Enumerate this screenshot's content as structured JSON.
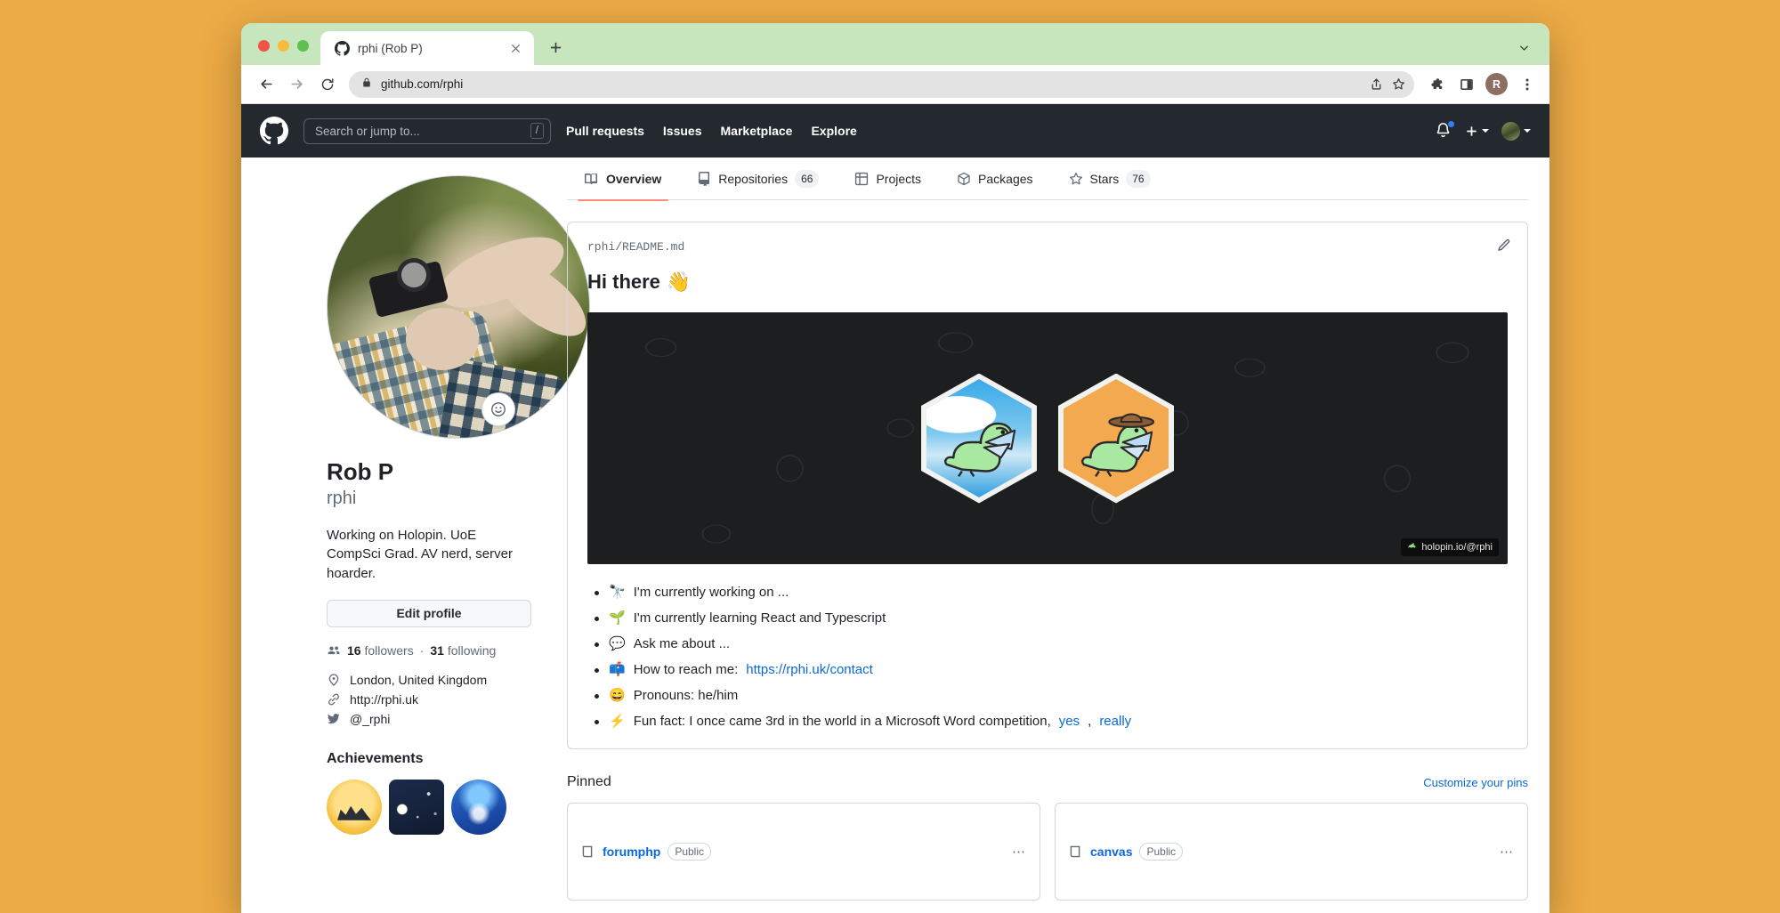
{
  "browser": {
    "tab": {
      "title": "rphi (Rob P)",
      "favicon": "github-icon"
    },
    "new_tab_label": "+",
    "address": "github.com/rphi",
    "lock_icon": "lock-icon",
    "back_icon": "back-arrow-icon",
    "forward_icon": "forward-arrow-icon",
    "reload_icon": "reload-icon",
    "share_icon": "share-icon",
    "bookmark_icon": "star-icon",
    "extensions_icon": "puzzle-icon",
    "sidepanel_icon": "side-panel-icon",
    "profile_initial": "R",
    "menu_icon": "three-dot-menu-icon",
    "tab_list_icon": "chevron-down-icon",
    "tabstrip_color": "#c8e6bd"
  },
  "github_header": {
    "logo": "github-octocat-logo",
    "search_placeholder": "Search or jump to...",
    "search_shortcut": "/",
    "nav": [
      {
        "label": "Pull requests"
      },
      {
        "label": "Issues"
      },
      {
        "label": "Marketplace"
      },
      {
        "label": "Explore"
      }
    ],
    "notifications_icon": "bell-icon",
    "has_unread": true,
    "unread_color": "#2f81f7",
    "create_new_icon": "plus-icon",
    "account_icon": "user-avatar"
  },
  "profile": {
    "avatar_alt": "person lying in grass holding a camera",
    "status_button_icon": "smiley-face-icon",
    "name": "Rob P",
    "login": "rphi",
    "bio": "Working on Holopin. UoE CompSci Grad. AV nerd, server hoarder.",
    "edit_button": "Edit profile",
    "followers_count": "16",
    "followers_label": "followers",
    "separator": "·",
    "following_count": "31",
    "following_label": "following",
    "people_icon": "people-icon",
    "details": [
      {
        "icon": "location-icon",
        "text": "London, United Kingdom"
      },
      {
        "icon": "link-icon",
        "text": "http://rphi.uk"
      },
      {
        "icon": "twitter-icon",
        "text": "@_rphi"
      }
    ],
    "achievements_title": "Achievements",
    "achievements": [
      {
        "name": "mars-2020-contributor-badge"
      },
      {
        "name": "starstruck-badge"
      },
      {
        "name": "pull-shark-badge"
      }
    ]
  },
  "tabs": [
    {
      "label": "Overview",
      "icon": "book-icon",
      "count": null,
      "active": true
    },
    {
      "label": "Repositories",
      "icon": "repo-icon",
      "count": "66",
      "active": false
    },
    {
      "label": "Projects",
      "icon": "project-board-icon",
      "count": null,
      "active": false
    },
    {
      "label": "Packages",
      "icon": "package-icon",
      "count": null,
      "active": false
    },
    {
      "label": "Stars",
      "icon": "star-icon",
      "count": "76",
      "active": false
    }
  ],
  "readme": {
    "owner": "rphi",
    "slash": "/",
    "file": "README.md",
    "edit_icon": "pencil-icon",
    "heading": "Hi there",
    "heading_emoji": "👋",
    "banner": {
      "watermark": "holopin.io/@rphi",
      "watermark_icon": "holopin-dino-icon",
      "background_color": "#1d1e20",
      "badges": [
        {
          "name": "winged-dino-sky-badge",
          "bg": "#39a9e8"
        },
        {
          "name": "cowboy-dino-orange-badge",
          "bg": "#f2a94f"
        }
      ]
    },
    "bullets": [
      {
        "emoji": "🔭",
        "text": "I'm currently working on ...",
        "link": null,
        "link_text": null,
        "tail": null
      },
      {
        "emoji": "🌱",
        "text": "I'm currently learning React and Typescript",
        "link": null,
        "link_text": null,
        "tail": null
      },
      {
        "emoji": "💬",
        "text": "Ask me about ...",
        "link": null,
        "link_text": null,
        "tail": null
      },
      {
        "emoji": "📫",
        "text": "How to reach me: ",
        "link_text": "https://rphi.uk/contact",
        "tail": null
      },
      {
        "emoji": "😄",
        "text": "Pronouns: he/him",
        "link": null,
        "link_text": null,
        "tail": null
      },
      {
        "emoji": "⚡",
        "text": "Fun fact: I once came 3rd in the world in a Microsoft Word competition, ",
        "link_text": "yes",
        "tail": ", ",
        "link_text2": "really"
      }
    ]
  },
  "pinned": {
    "title": "Pinned",
    "customize_link": "Customize your pins",
    "cards": [
      {
        "name": "forumphp",
        "visibility": "Public",
        "menu_icon": "kebab-menu-icon",
        "repo_icon": "repo-icon"
      },
      {
        "name": "canvas",
        "visibility": "Public",
        "menu_icon": "kebab-menu-icon",
        "repo_icon": "repo-icon"
      }
    ]
  },
  "colors": {
    "page_background": "#edab45",
    "gh_header": "#24292f",
    "accent_link": "#0969da",
    "active_tab_underline": "#fd8c73"
  }
}
